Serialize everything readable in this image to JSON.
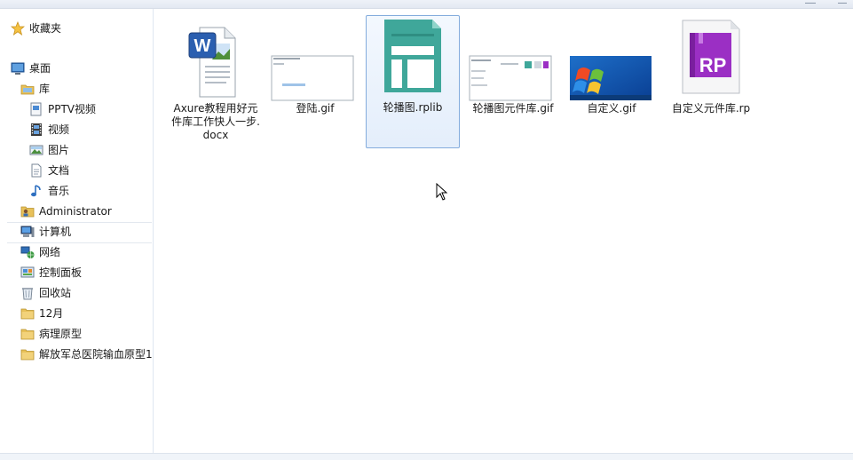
{
  "sidebar": {
    "favorites_label": "收藏夹",
    "desktop_label": "桌面",
    "libraries_label": "库",
    "library_items": [
      "PPTV视频",
      "视频",
      "图片",
      "文档",
      "音乐"
    ],
    "user_label": "Administrator",
    "computer_label": "计算机",
    "network_label": "网络",
    "control_panel_label": "控制面板",
    "recycle_bin_label": "回收站",
    "folders": [
      "12月",
      "病理原型",
      "解放军总医院输血原型1"
    ]
  },
  "files": [
    {
      "name": "Axure教程用好元件库工作快人一步.docx",
      "icon": "word-doc-icon"
    },
    {
      "name": "登陆.gif",
      "icon": "gif-thumbnail"
    },
    {
      "name": "轮播图.rplib",
      "icon": "rplib-icon",
      "selected": true
    },
    {
      "name": "轮播图元件库.gif",
      "icon": "gif-thumbnail"
    },
    {
      "name": "自定义.gif",
      "icon": "windows7-thumbnail"
    },
    {
      "name": "自定义元件库.rp",
      "icon": "rp-file-icon"
    }
  ],
  "colors": {
    "selection_border": "#84acdd",
    "rplib_green": "#3fa79a",
    "rp_purple": "#9b2fc4",
    "folder_yellow": "#e8c15a"
  }
}
